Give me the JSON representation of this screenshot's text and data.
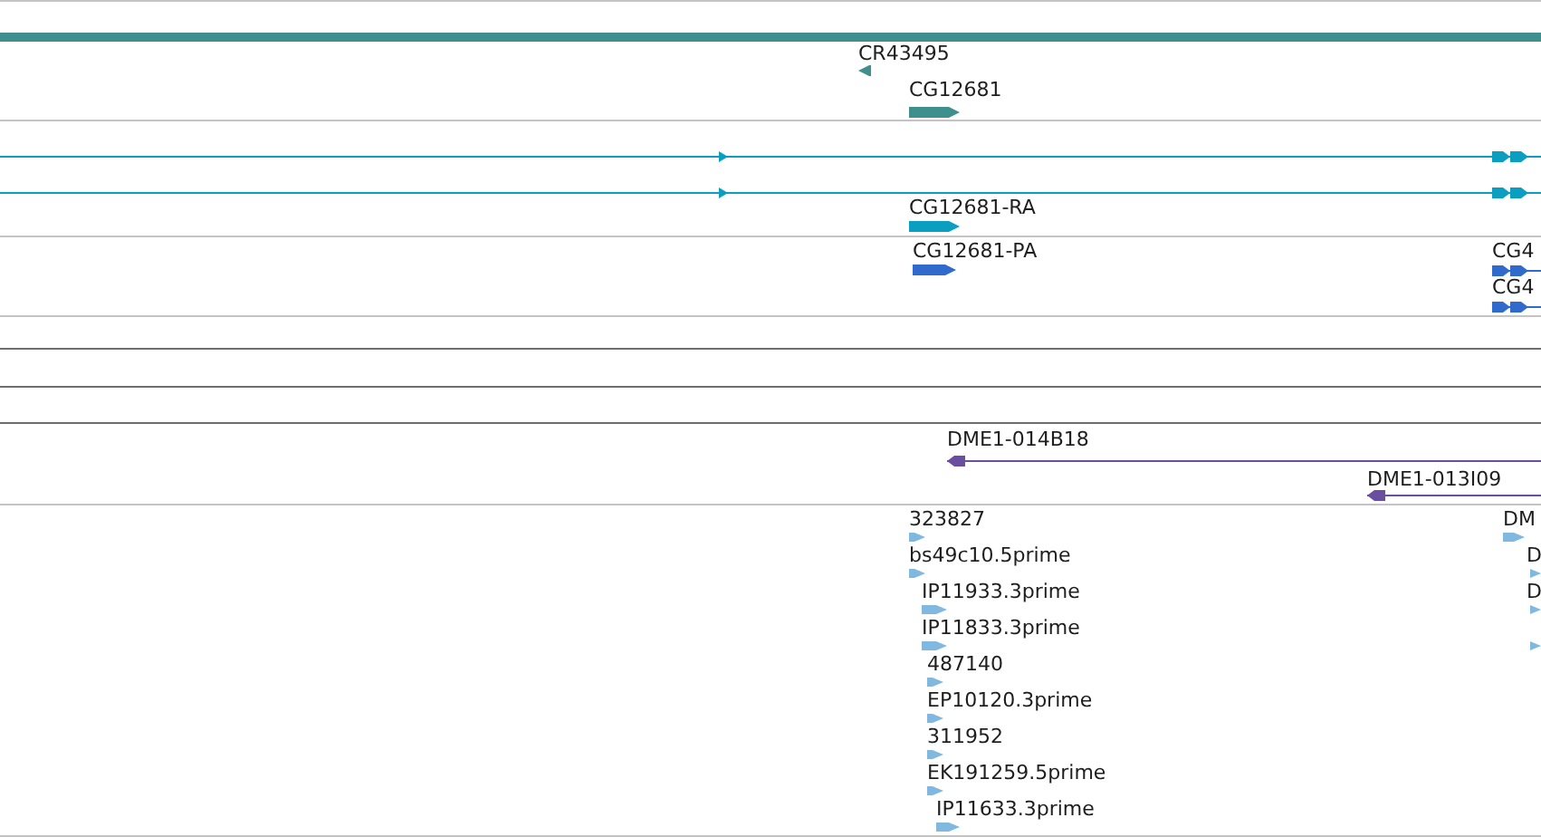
{
  "tracks": [
    {
      "kind": "genes",
      "color": "#3f8f8f",
      "features": [
        {
          "kind": "span"
        },
        {
          "kind": "block",
          "label": "CR43495",
          "reverse": true
        },
        {
          "kind": "block",
          "label": "CG12681",
          "reverse": false
        }
      ]
    },
    {
      "kind": "transcripts",
      "color": "#0a9ec0",
      "features": [
        {
          "kind": "line",
          "reverse": false
        },
        {
          "kind": "line",
          "reverse": false
        },
        {
          "kind": "block",
          "label": "CG12681-RA",
          "reverse": false
        }
      ]
    },
    {
      "kind": "proteins",
      "color": "#2f6acc",
      "features": [
        {
          "kind": "block",
          "label": "CG12681-PA",
          "reverse": false
        },
        {
          "kind": "line",
          "label": "CG4",
          "reverse": false
        },
        {
          "kind": "line",
          "label": "CG4",
          "reverse": false
        }
      ]
    },
    {
      "kind": "empty"
    },
    {
      "kind": "empty"
    },
    {
      "kind": "empty"
    },
    {
      "kind": "clones",
      "color": "#6a4ea0",
      "features": [
        {
          "kind": "line",
          "label": "DME1-014B18",
          "reverse": true
        },
        {
          "kind": "line",
          "label": "DME1-013I09",
          "reverse": true
        }
      ]
    },
    {
      "kind": "ests",
      "color": "#80b8e0",
      "features": [
        {
          "kind": "block",
          "label": "323827",
          "reverse": false
        },
        {
          "kind": "block",
          "label": "bs49c10.5prime",
          "reverse": false
        },
        {
          "kind": "block",
          "label": "IP11933.3prime",
          "reverse": false
        },
        {
          "kind": "block",
          "label": "IP11833.3prime",
          "reverse": false
        },
        {
          "kind": "block",
          "label": "487140",
          "reverse": false
        },
        {
          "kind": "block",
          "label": "EP10120.3prime",
          "reverse": false
        },
        {
          "kind": "block",
          "label": "311952",
          "reverse": false
        },
        {
          "kind": "block",
          "label": "EK191259.5prime",
          "reverse": false
        },
        {
          "kind": "block",
          "label": "IP11633.3prime",
          "reverse": false
        },
        {
          "kind": "block",
          "label": "DM",
          "reverse": false
        },
        {
          "kind": "block",
          "label": "D",
          "reverse": false
        },
        {
          "kind": "block",
          "label": "D",
          "reverse": false
        },
        {
          "kind": "block",
          "reverse": false
        }
      ]
    }
  ]
}
